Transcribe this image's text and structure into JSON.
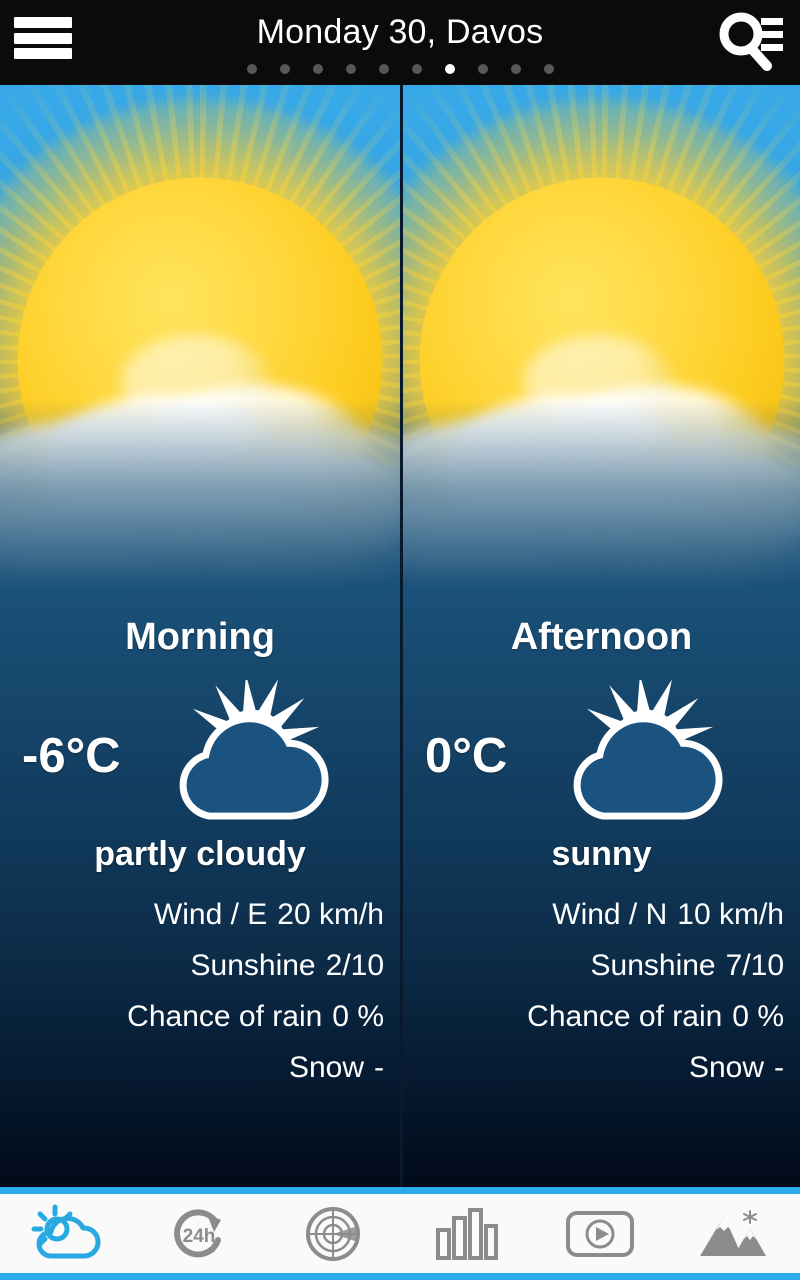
{
  "header": {
    "title": "Monday 30, Davos",
    "menu_icon": "hamburger-menu-icon",
    "search_icon": "search-list-icon",
    "pager": {
      "total": 10,
      "active_index": 6
    }
  },
  "panels": [
    {
      "period": "Morning",
      "temperature": "-6°C",
      "condition": "partly cloudy",
      "condition_icon": "sun-behind-cloud-icon",
      "background_icon": "sun-cloud-photo",
      "stats": [
        {
          "label": "Wind / E",
          "value": "20 km/h",
          "combined": true
        },
        {
          "label": "Sunshine",
          "value": "2/10",
          "combined": false
        },
        {
          "label": "Chance of rain",
          "value": "0 %",
          "combined": false
        },
        {
          "label": "Snow",
          "value": "-",
          "combined": false
        }
      ]
    },
    {
      "period": "Afternoon",
      "temperature": "0°C",
      "condition": "sunny",
      "condition_icon": "sun-behind-cloud-icon",
      "background_icon": "sun-cloud-photo",
      "stats": [
        {
          "label": "Wind / N",
          "value": "10 km/h",
          "combined": true
        },
        {
          "label": "Sunshine",
          "value": "7/10",
          "combined": false
        },
        {
          "label": "Chance of rain",
          "value": "0 %",
          "combined": false
        },
        {
          "label": "Snow",
          "value": "-",
          "combined": false
        }
      ]
    }
  ],
  "navbar": {
    "items": [
      {
        "name": "forecast",
        "icon": "sun-cloud-icon",
        "active": true
      },
      {
        "name": "hourly-24h",
        "icon": "24h-refresh-icon",
        "active": false
      },
      {
        "name": "radar",
        "icon": "radar-icon",
        "active": false
      },
      {
        "name": "charts",
        "icon": "bar-chart-icon",
        "active": false
      },
      {
        "name": "video",
        "icon": "video-play-icon",
        "active": false
      },
      {
        "name": "snow-report",
        "icon": "snowy-mountains-icon",
        "active": false
      }
    ],
    "active_color": "#29a9e1",
    "inactive_color": "#8c8c8c",
    "accent_color": "#2cacea"
  },
  "colors": {
    "header_bg": "#0b0b0b",
    "sky": "#35a8e8",
    "sun": "#ffd73c",
    "panel_bottom": "#020a18",
    "nav_bg": "#fafafa"
  }
}
